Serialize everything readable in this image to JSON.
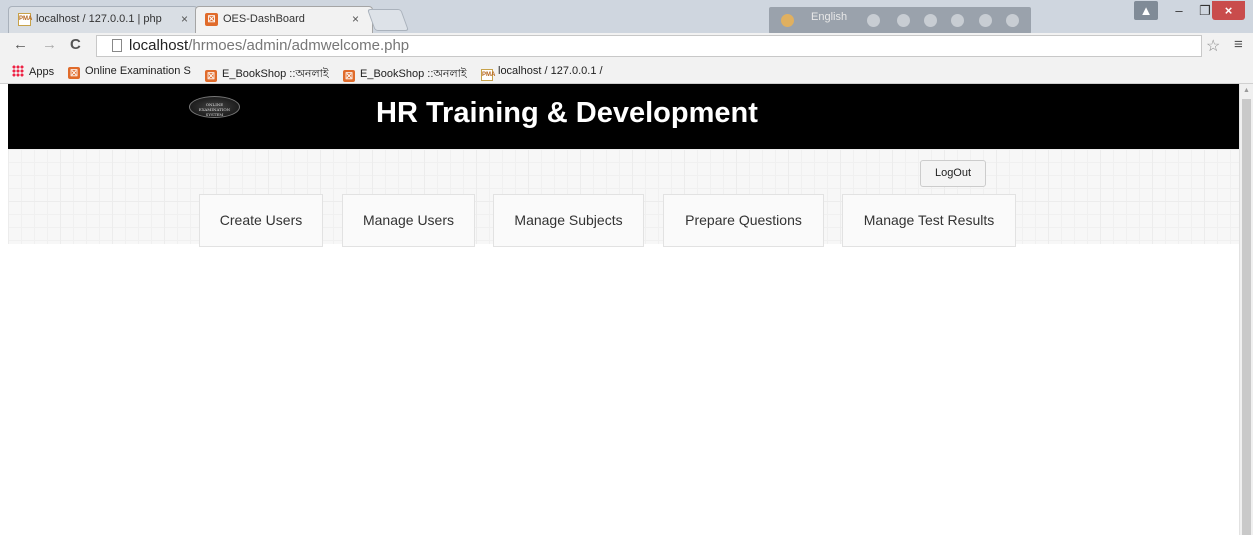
{
  "browser": {
    "tabs": [
      {
        "title": "localhost / 127.0.0.1 | php"
      },
      {
        "title": "OES-DashBoard"
      }
    ],
    "favicon_pma": "PMA",
    "favicon_oes": "☒",
    "close_glyph": "×",
    "extension_language": "English",
    "url_host": "localhost",
    "url_path": "/hrmoes/admin/admwelcome.php",
    "nav_back": "←",
    "nav_forward": "→",
    "nav_reload": "C",
    "star": "☆",
    "menu": "≡",
    "window_user": "▲",
    "window_minimize": "–",
    "window_maximize": "❐",
    "window_close": "×"
  },
  "bookmarks": [
    {
      "label": "Apps"
    },
    {
      "label": "Online Examination S"
    },
    {
      "label": "E_BookShop ::অনলাই"
    },
    {
      "label": "E_BookShop ::অনলাই"
    },
    {
      "label": "localhost / 127.0.0.1 /"
    }
  ],
  "page": {
    "logo_text": "ONLINE EXAMINATION SYSTEM",
    "title": "HR Training & Development",
    "logout_label": "LogOut",
    "menu": [
      {
        "label": "Create Users"
      },
      {
        "label": "Manage Users"
      },
      {
        "label": "Manage Subjects"
      },
      {
        "label": "Prepare Questions"
      },
      {
        "label": "Manage Test Results"
      }
    ]
  },
  "colors": {
    "header_bg": "#000000",
    "title_text": "#ffffff",
    "close_button": "#c94c4c"
  }
}
